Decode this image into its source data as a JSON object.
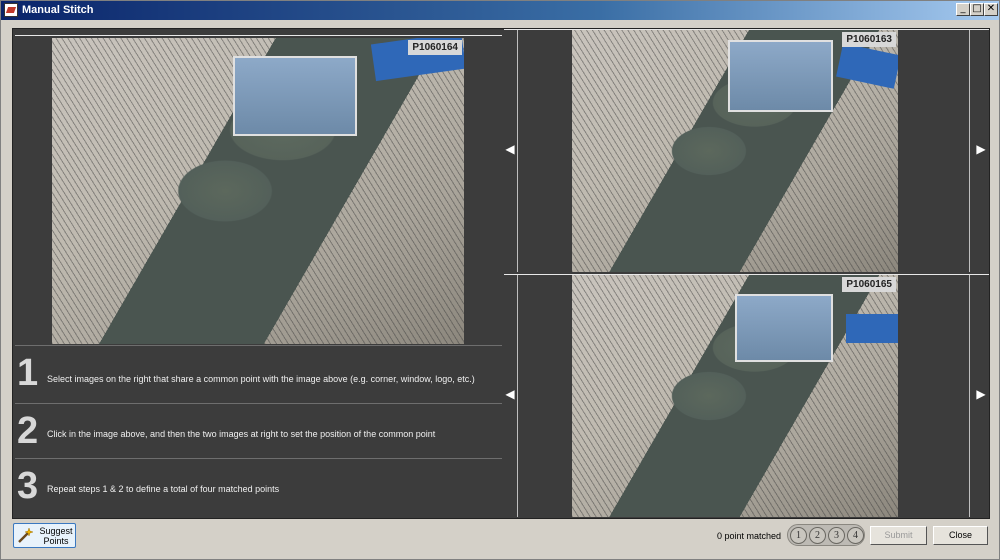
{
  "window": {
    "title": "Manual Stitch",
    "controls": {
      "minimize": "_",
      "maximize": "□",
      "close": "✕"
    }
  },
  "main_image": {
    "label": "P1060164"
  },
  "thumbnails": [
    {
      "label": "P1060163",
      "prev_arrow": "◀",
      "next_arrow": "▶"
    },
    {
      "label": "P1060165",
      "prev_arrow": "◀",
      "next_arrow": "▶"
    }
  ],
  "steps": [
    {
      "number": "1",
      "text": "Select images on the right that share a common point with the image above (e.g. corner, window, logo, etc.)"
    },
    {
      "number": "2",
      "text": "Click in the image above, and then the two images at right to set the position of the common point"
    },
    {
      "number": "3",
      "text": "Repeat steps 1 & 2 to define a total of four matched points"
    }
  ],
  "footer": {
    "suggest_button_label": "Suggest Points",
    "matched_status": "0 point matched",
    "match_indicators": [
      "1",
      "2",
      "3",
      "4"
    ],
    "submit_label": "Submit",
    "close_label": "Close"
  },
  "colors": {
    "panel_bg": "#3c3c3c",
    "window_bg": "#d4d0c8",
    "title_gradient_start": "#0a246a"
  },
  "icons": {
    "title": "app-icon",
    "suggest": "magic-wand-icon"
  }
}
